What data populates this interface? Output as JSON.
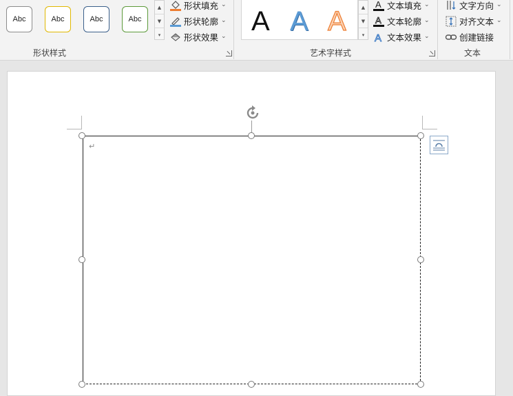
{
  "ribbon": {
    "shape_styles_group": {
      "label": "形状样式",
      "presets": [
        {
          "text": "Abc",
          "border_color": "#8c8c8c"
        },
        {
          "text": "Abc",
          "border_color": "#e0b800"
        },
        {
          "text": "Abc",
          "border_color": "#3b5f8a"
        },
        {
          "text": "Abc",
          "border_color": "#5c9a3a"
        }
      ],
      "commands": {
        "fill": "形状填充",
        "outline": "形状轮廓",
        "effects": "形状效果"
      }
    },
    "wordart_group": {
      "label": "艺术字样式",
      "letters": [
        "A",
        "A",
        "A"
      ],
      "commands": {
        "fill": "文本填充",
        "outline": "文本轮廓",
        "effects": "文本效果"
      }
    },
    "text_group": {
      "label": "文本",
      "commands": {
        "direction": "文字方向",
        "align": "对齐文本",
        "link": "创建链接"
      }
    }
  },
  "document": {
    "paragraph_mark": "↵"
  },
  "colors": {
    "accent_orange": "#ed7d31",
    "accent_blue": "#5b9bd5",
    "ribbon_bg": "#f3f3f3",
    "canvas_bg": "#e6e6e6"
  }
}
